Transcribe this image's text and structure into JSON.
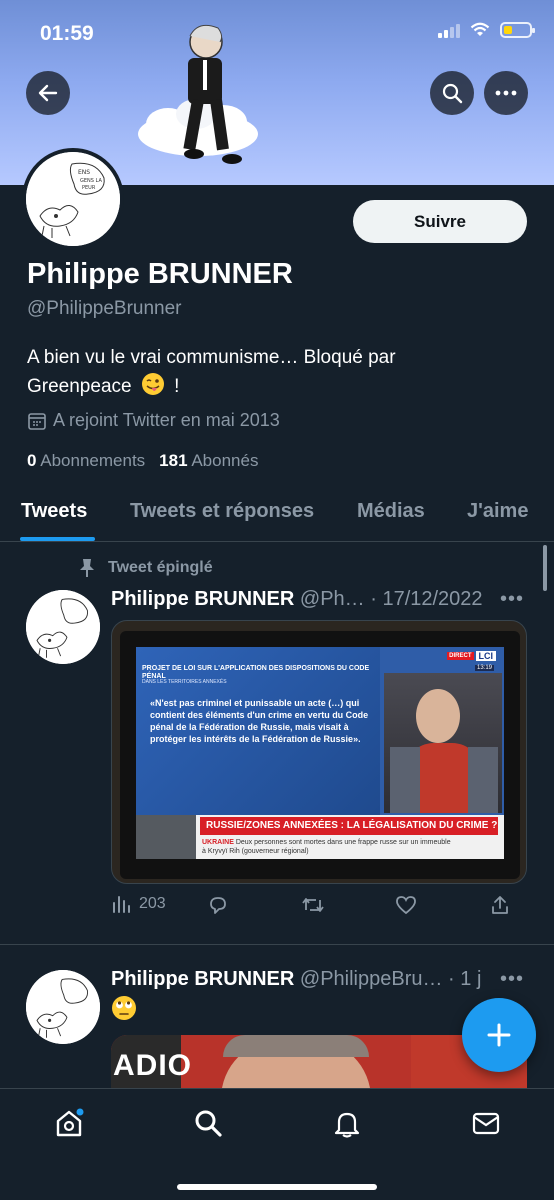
{
  "status_bar": {
    "time": "01:59"
  },
  "profile": {
    "name": "Philippe BRUNNER",
    "handle": "@PhilippeBrunner",
    "bio_line1": "A bien vu le vrai communisme… Bloqué par",
    "bio_line2": "Greenpeace",
    "bio_end": "!",
    "joined": "A rejoint Twitter en mai 2013",
    "following_count": "0",
    "following_label": "Abonnements",
    "followers_count": "181",
    "followers_label": "Abonnés",
    "follow_label": "Suivre"
  },
  "tabs": [
    "Tweets",
    "Tweets et réponses",
    "Médias",
    "J'aime"
  ],
  "tweets": [
    {
      "pinned_label": "Tweet épinglé",
      "author": "Philippe BRUNNER",
      "meta": "@Ph… · 17/12/2022",
      "views": "203",
      "tv": {
        "header": "PROJET DE LOI SUR L'APPLICATION DES DISPOSITIONS DU CODE PÉNAL",
        "subheader": "DANS LES TERRITOIRES ANNEXÉS",
        "quote": "«N'est pas criminel et punissable un acte (…) qui contient des éléments d'un crime en vertu du Code pénal de la Fédération de Russie, mais visait à protéger les intérêts de la Fédération de Russie».",
        "headline": "RUSSIE/ZONES ANNEXÉES : LA LÉGALISATION DU CRIME ?",
        "ticker_tag": "UKRAINE",
        "ticker_text": "Deux personnes sont mortes dans une frappe russe sur un immeuble",
        "ticker_text2": "à Kryvyï Rih (gouverneur régional)",
        "channel": "LCI",
        "live": "DIRECT",
        "clock": "13:19"
      }
    },
    {
      "author": "Philippe BRUNNER",
      "meta": "@PhilippeBru… · 1 j",
      "media_text": "ADIO"
    }
  ],
  "colors": {
    "accent": "#1d9bf0",
    "background": "#15202b",
    "muted": "#8b98a5"
  }
}
